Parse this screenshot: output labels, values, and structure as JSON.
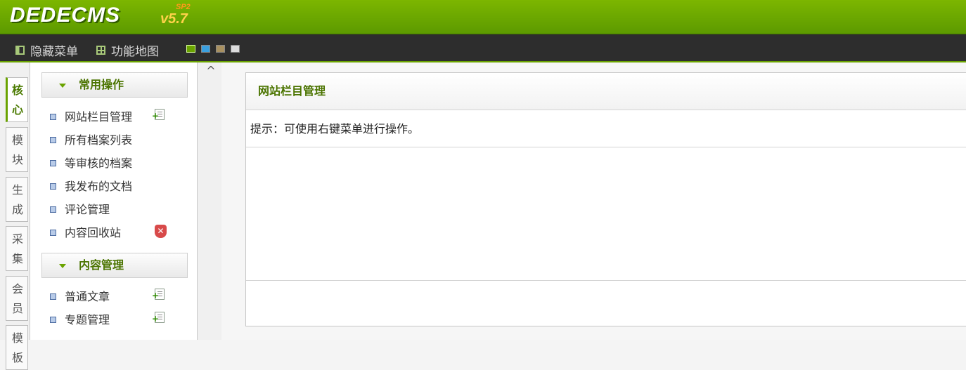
{
  "header": {
    "logo": "DEDECMS",
    "version": "v5.7",
    "sp": "SP2"
  },
  "toolbar": {
    "hide_menu": "隐藏菜单",
    "function_map": "功能地图",
    "skins": [
      "#6aa300",
      "#3aa0e0",
      "#a89060",
      "#dddddd"
    ]
  },
  "left_tabs": [
    {
      "label": "核心",
      "active": true
    },
    {
      "label": "模块"
    },
    {
      "label": "生成"
    },
    {
      "label": "采集"
    },
    {
      "label": "会员"
    },
    {
      "label": "模板"
    }
  ],
  "menu": {
    "groups": [
      {
        "title": "常用操作",
        "items": [
          "网站栏目管理",
          "所有档案列表",
          "等审核的档案",
          "我发布的文档",
          "评论管理",
          "内容回收站"
        ]
      },
      {
        "title": "内容管理",
        "items": [
          "普通文章",
          "专题管理"
        ]
      }
    ]
  },
  "main": {
    "title": "网站栏目管理",
    "tip": "提示：可使用右键菜单进行操作。"
  }
}
